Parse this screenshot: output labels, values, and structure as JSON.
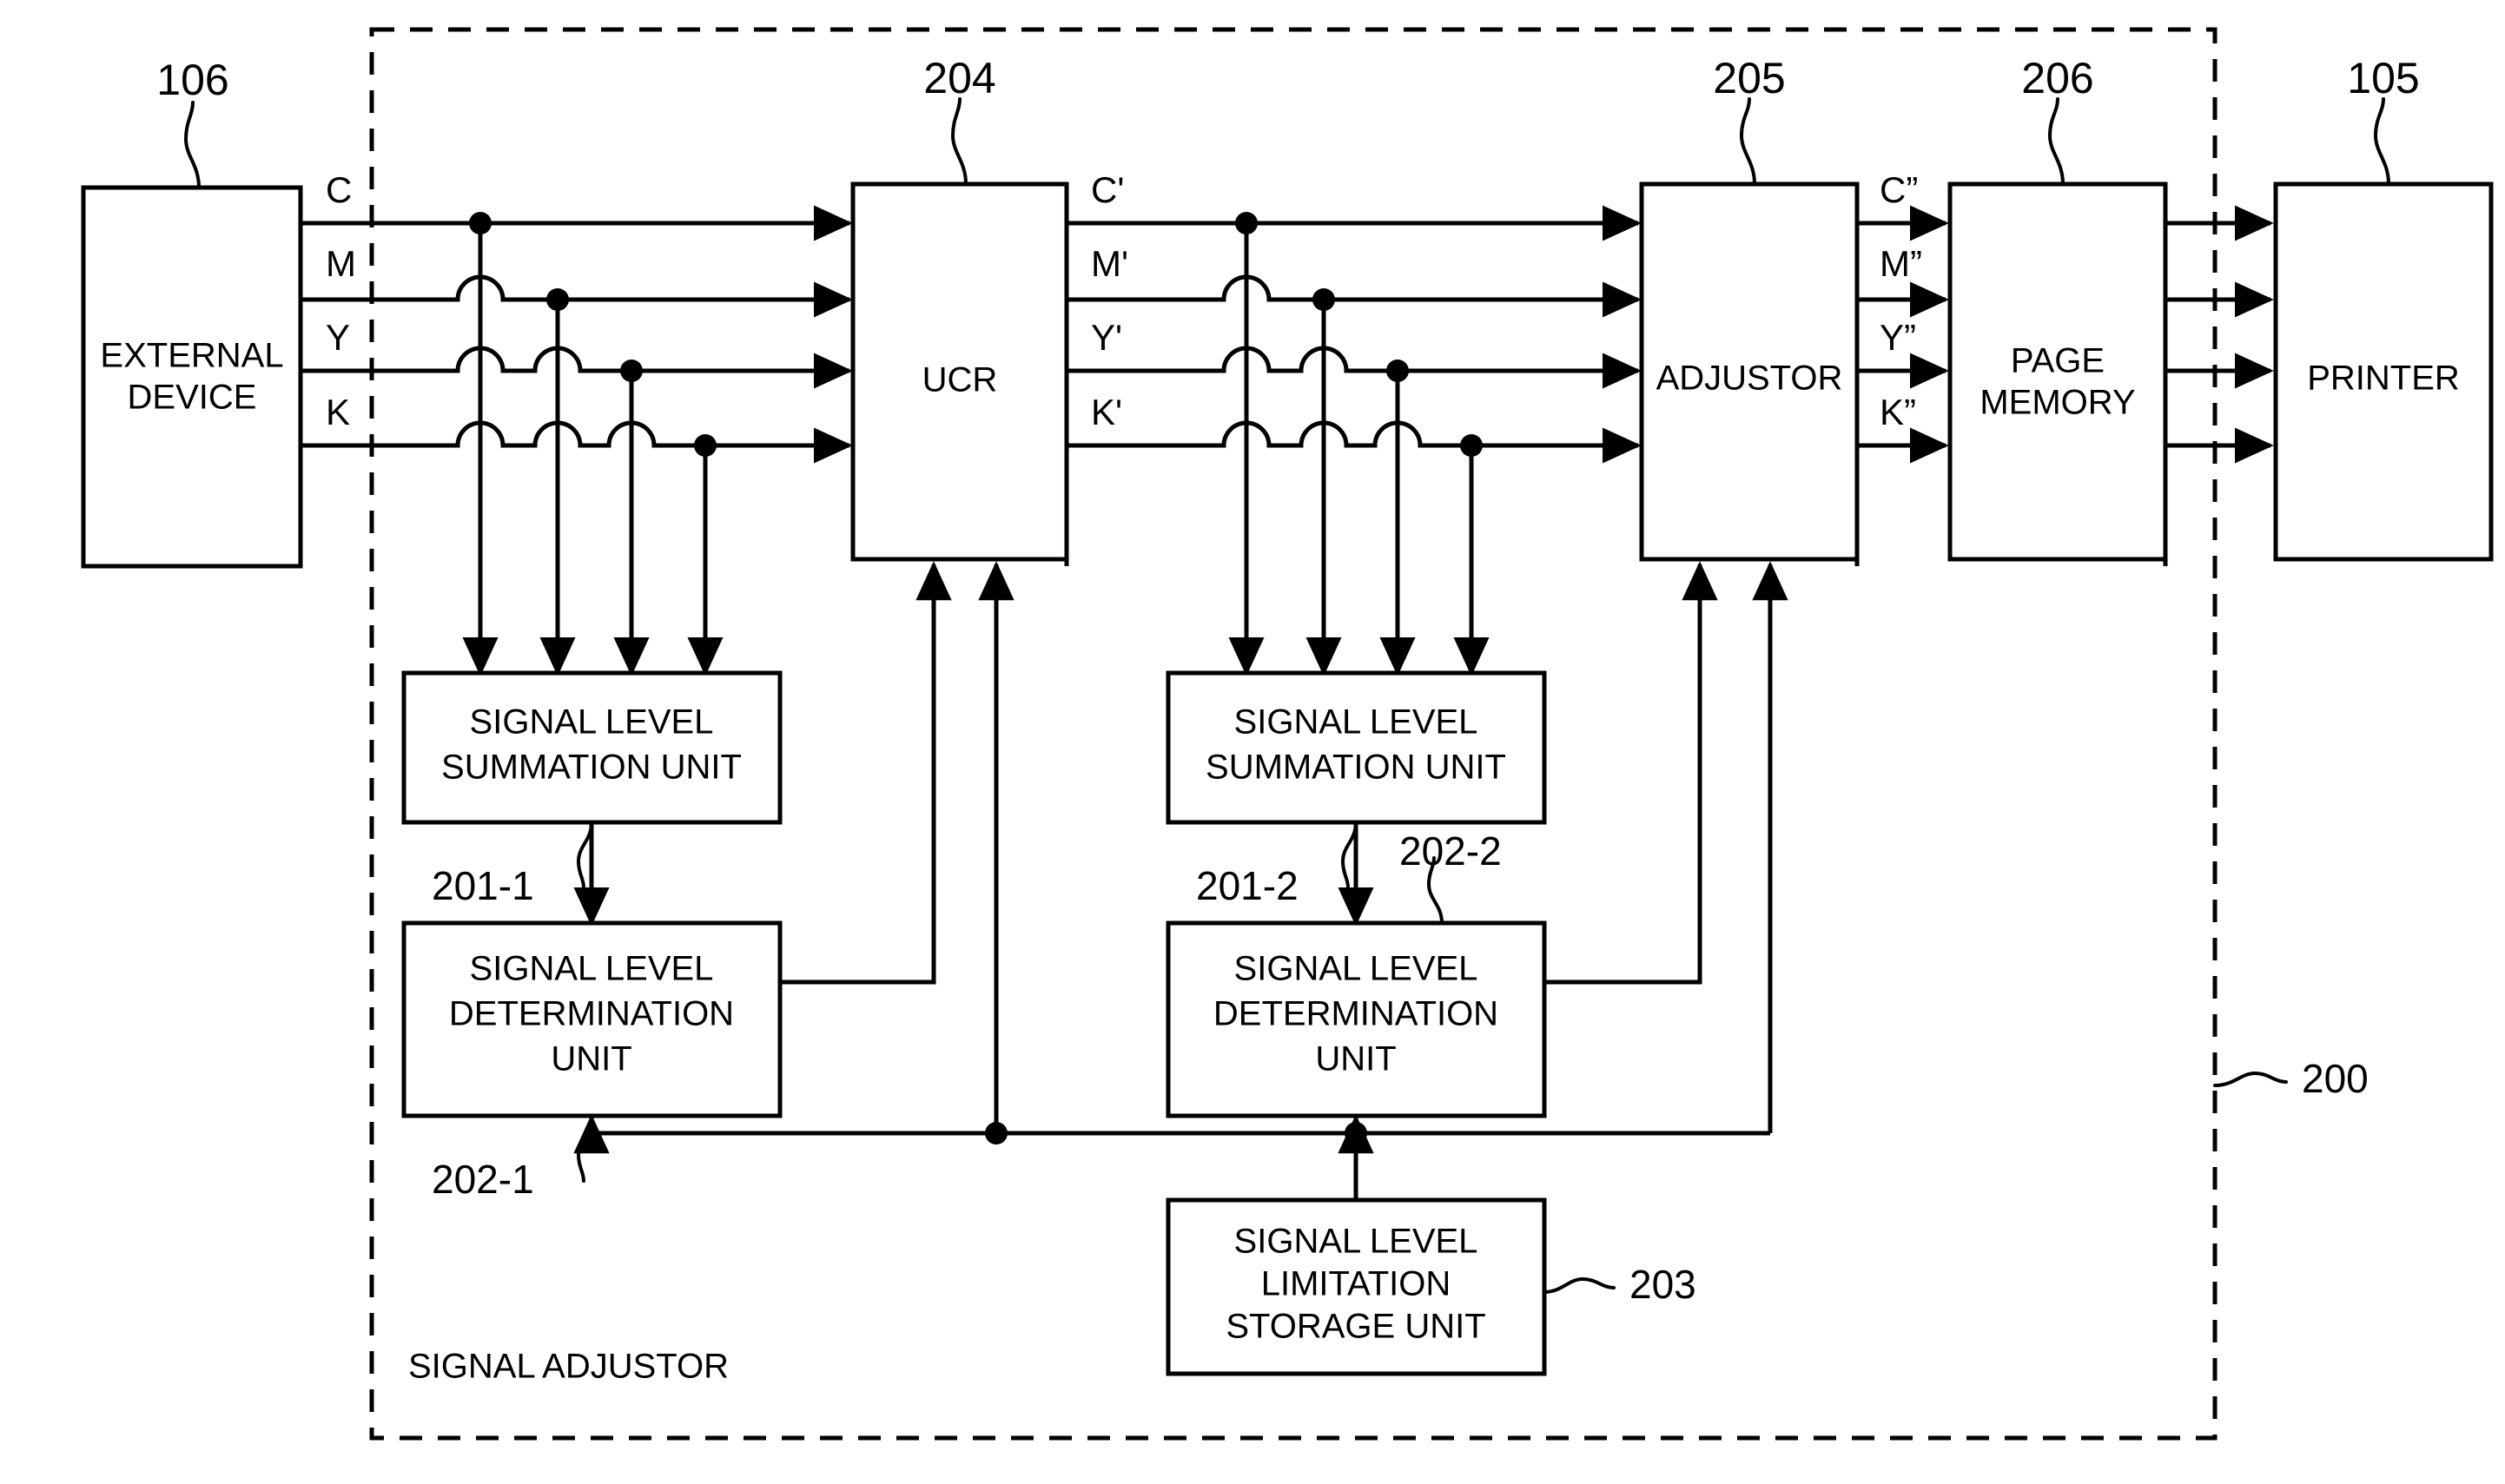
{
  "figure": {
    "type": "patent-block-diagram",
    "enclosure_label": "SIGNAL ADJUSTOR",
    "enclosure_ref": "200"
  },
  "blocks": {
    "external_device": {
      "label_line1": "EXTERNAL",
      "label_line2": "DEVICE",
      "ref": "106"
    },
    "ucr": {
      "label": "UCR",
      "ref": "204"
    },
    "adjustor": {
      "label": "ADJUSTOR",
      "ref": "205"
    },
    "page_memory": {
      "label_line1": "PAGE",
      "label_line2": "MEMORY",
      "ref": "206"
    },
    "printer": {
      "label": "PRINTER",
      "ref": "105"
    },
    "summation_1": {
      "label_line1": "SIGNAL LEVEL",
      "label_line2": "SUMMATION UNIT",
      "ref": "201-1"
    },
    "determination_1": {
      "label_line1": "SIGNAL LEVEL",
      "label_line2": "DETERMINATION",
      "label_line3": "UNIT",
      "ref": "202-1"
    },
    "summation_2": {
      "label_line1": "SIGNAL LEVEL",
      "label_line2": "SUMMATION UNIT",
      "ref": "201-2"
    },
    "determination_2": {
      "label_line1": "SIGNAL LEVEL",
      "label_line2": "DETERMINATION",
      "label_line3": "UNIT",
      "ref": "202-2"
    },
    "limitation_storage": {
      "label_line1": "SIGNAL LEVEL",
      "label_line2": "LIMITATION",
      "label_line3": "STORAGE UNIT",
      "ref": "203"
    }
  },
  "signals": {
    "input": {
      "c": "C",
      "m": "M",
      "y": "Y",
      "k": "K"
    },
    "mid": {
      "c": "C'",
      "m": "M'",
      "y": "Y'",
      "k": "K'"
    },
    "out": {
      "c": "C”",
      "m": "M”",
      "y": "Y”",
      "k": "K”"
    }
  },
  "colors": {
    "ink": "#000000",
    "paper": "#ffffff"
  }
}
